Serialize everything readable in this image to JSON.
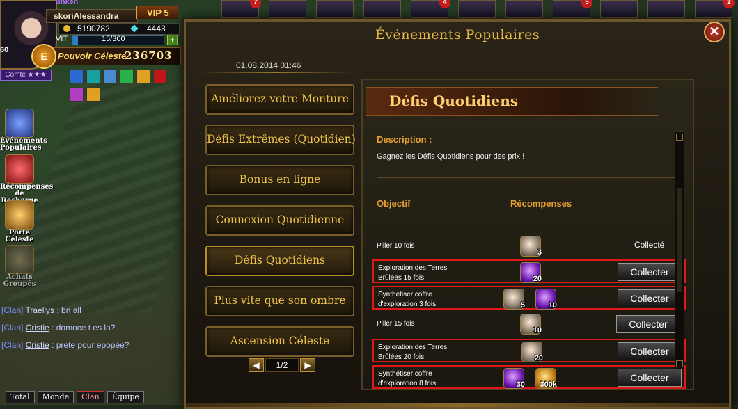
{
  "player": {
    "name": "Alessandra",
    "name_prefix": "skori",
    "name_top": "unken",
    "vip": "VIP 5",
    "gold": "5190782",
    "diamonds": "4443",
    "vit_label": "VIT",
    "vit_value": "15/300",
    "vit_fraction": 0.05,
    "power_badge": "E",
    "power_label": "Pouvoir Céleste",
    "power_value": "236703",
    "rank": "Comte ★★★",
    "level_left": "60"
  },
  "top_badges": [
    "7",
    "4",
    "5",
    "2"
  ],
  "side_icons": [
    {
      "label": "Événements Populaires"
    },
    {
      "label": "Récompenses de Recharge"
    },
    {
      "label": "Porte Céleste"
    },
    {
      "label": "Achats Groupés"
    }
  ],
  "chat": {
    "lines": [
      {
        "channel": "[Clan]",
        "nick": "Traellys",
        "msg": ": bn all"
      },
      {
        "channel": "[Clan]",
        "nick": "Cristie",
        "msg": ": domoce t es la?"
      },
      {
        "channel": "[Clan]",
        "nick": "Cristie",
        "msg": ": prete pour epopée?"
      }
    ],
    "tabs": [
      "Total",
      "Monde",
      "Clan",
      "Équipe"
    ]
  },
  "dialog": {
    "title": "Événements Populaires",
    "close": "✕",
    "date": "01.08.2014 01:46",
    "menu": [
      "Améliorez votre Monture",
      "Défis Extrêmes (Quotidien)",
      "Bonus en ligne",
      "Connexion Quotidienne",
      "Défis Quotidiens",
      "Plus vite que son ombre",
      "Ascension Céleste"
    ],
    "pager": {
      "text": "1/2",
      "prev": "◀",
      "next": "▶"
    },
    "panel": {
      "title": "Défis Quotidiens",
      "description_label": "Description :",
      "description": "Gagnez les Défis Quotidiens pour des prix !",
      "col_objective": "Objectif",
      "col_rewards": "Récompenses",
      "rows": [
        {
          "objective": "Piller 10 fois",
          "rewards": [
            {
              "type": "orb",
              "count": "3"
            }
          ],
          "status": "Collecté",
          "highlight": false
        },
        {
          "objective": "Exploration des Terres Brûlées 15 fois",
          "rewards": [
            {
              "type": "purple",
              "count": "20"
            }
          ],
          "status": "Collecter",
          "highlight": true
        },
        {
          "objective": "Synthétiser coffre d'exploration 3 fois",
          "rewards": [
            {
              "type": "orb",
              "count": "5"
            },
            {
              "type": "purple",
              "count": "10"
            }
          ],
          "status": "Collecter",
          "highlight": true
        },
        {
          "objective": "Piller 15 fois",
          "rewards": [
            {
              "type": "orb",
              "count": "10"
            }
          ],
          "status": "Collecter",
          "highlight": false
        },
        {
          "objective": "Exploration des Terres Brûlées 20 fois",
          "rewards": [
            {
              "type": "orb",
              "count": "20"
            }
          ],
          "status": "Collecter",
          "highlight": true
        },
        {
          "objective": "Synthétiser coffre d'exploration 8 fois",
          "rewards": [
            {
              "type": "purple",
              "count": "30"
            },
            {
              "type": "gold",
              "count": "300k"
            }
          ],
          "status": "Collecter",
          "highlight": true
        }
      ]
    }
  }
}
